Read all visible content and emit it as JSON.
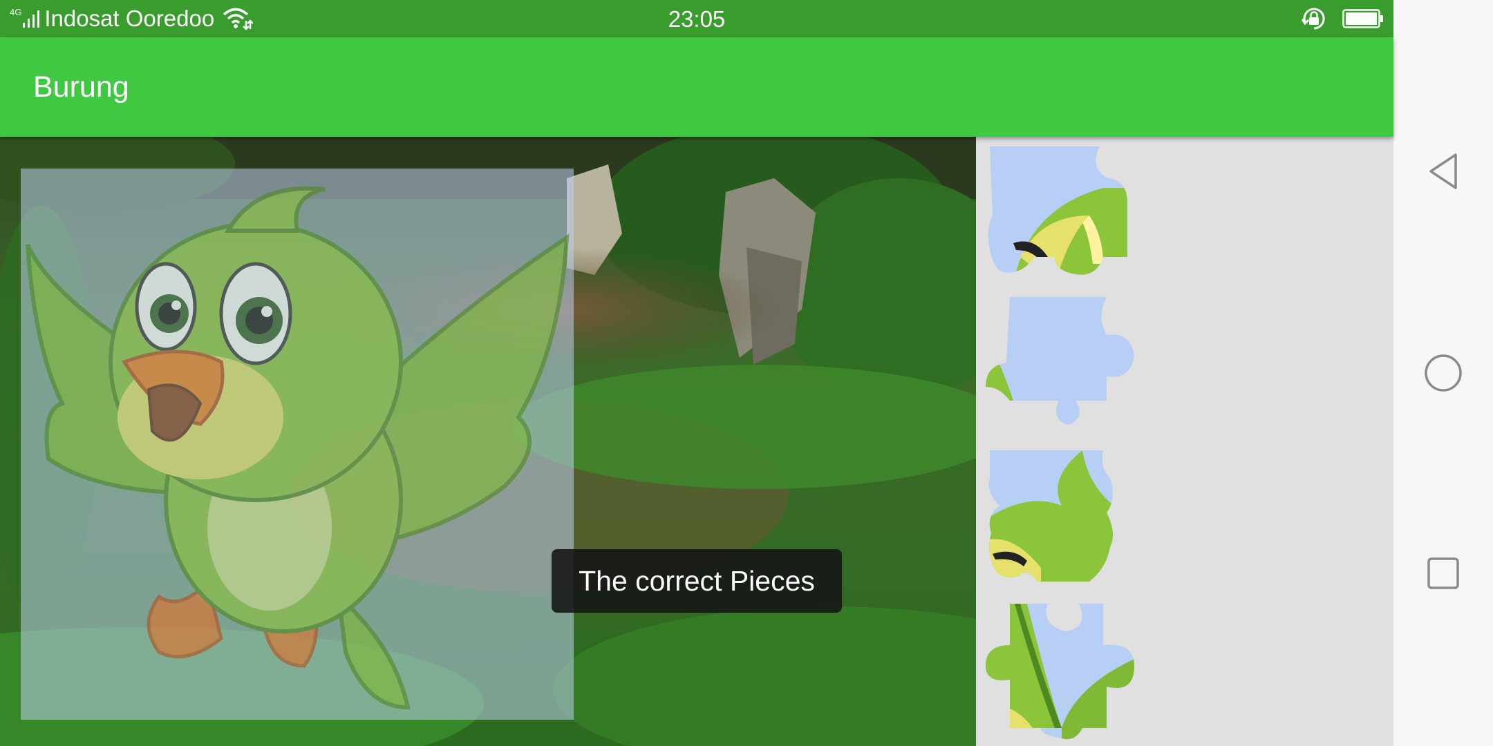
{
  "status_bar": {
    "network_type": "4G",
    "carrier": "Indosat Ooredoo",
    "time": "23:05",
    "icons": [
      "signal-icon",
      "wifi-icon",
      "rotation-lock-icon",
      "battery-icon"
    ]
  },
  "app_bar": {
    "title": "Burung"
  },
  "toast": {
    "message": "The correct Pieces"
  },
  "pieces": [
    {
      "name": "puzzle-piece-1",
      "icon": "bird-eye-piece"
    },
    {
      "name": "puzzle-piece-2",
      "icon": "sky-piece"
    },
    {
      "name": "puzzle-piece-3",
      "icon": "bird-crest-piece"
    },
    {
      "name": "puzzle-piece-4",
      "icon": "bird-wing-piece"
    }
  ],
  "nav_bar": {
    "buttons": [
      "back-icon",
      "home-icon",
      "recents-icon"
    ]
  },
  "colors": {
    "status_bar": "#399d2d",
    "app_bar": "#41c843",
    "tray": "#e0e0e0",
    "bird_green": "#8cc43a",
    "bird_beak": "#f07d1e",
    "sky_piece": "#b7cff5"
  }
}
